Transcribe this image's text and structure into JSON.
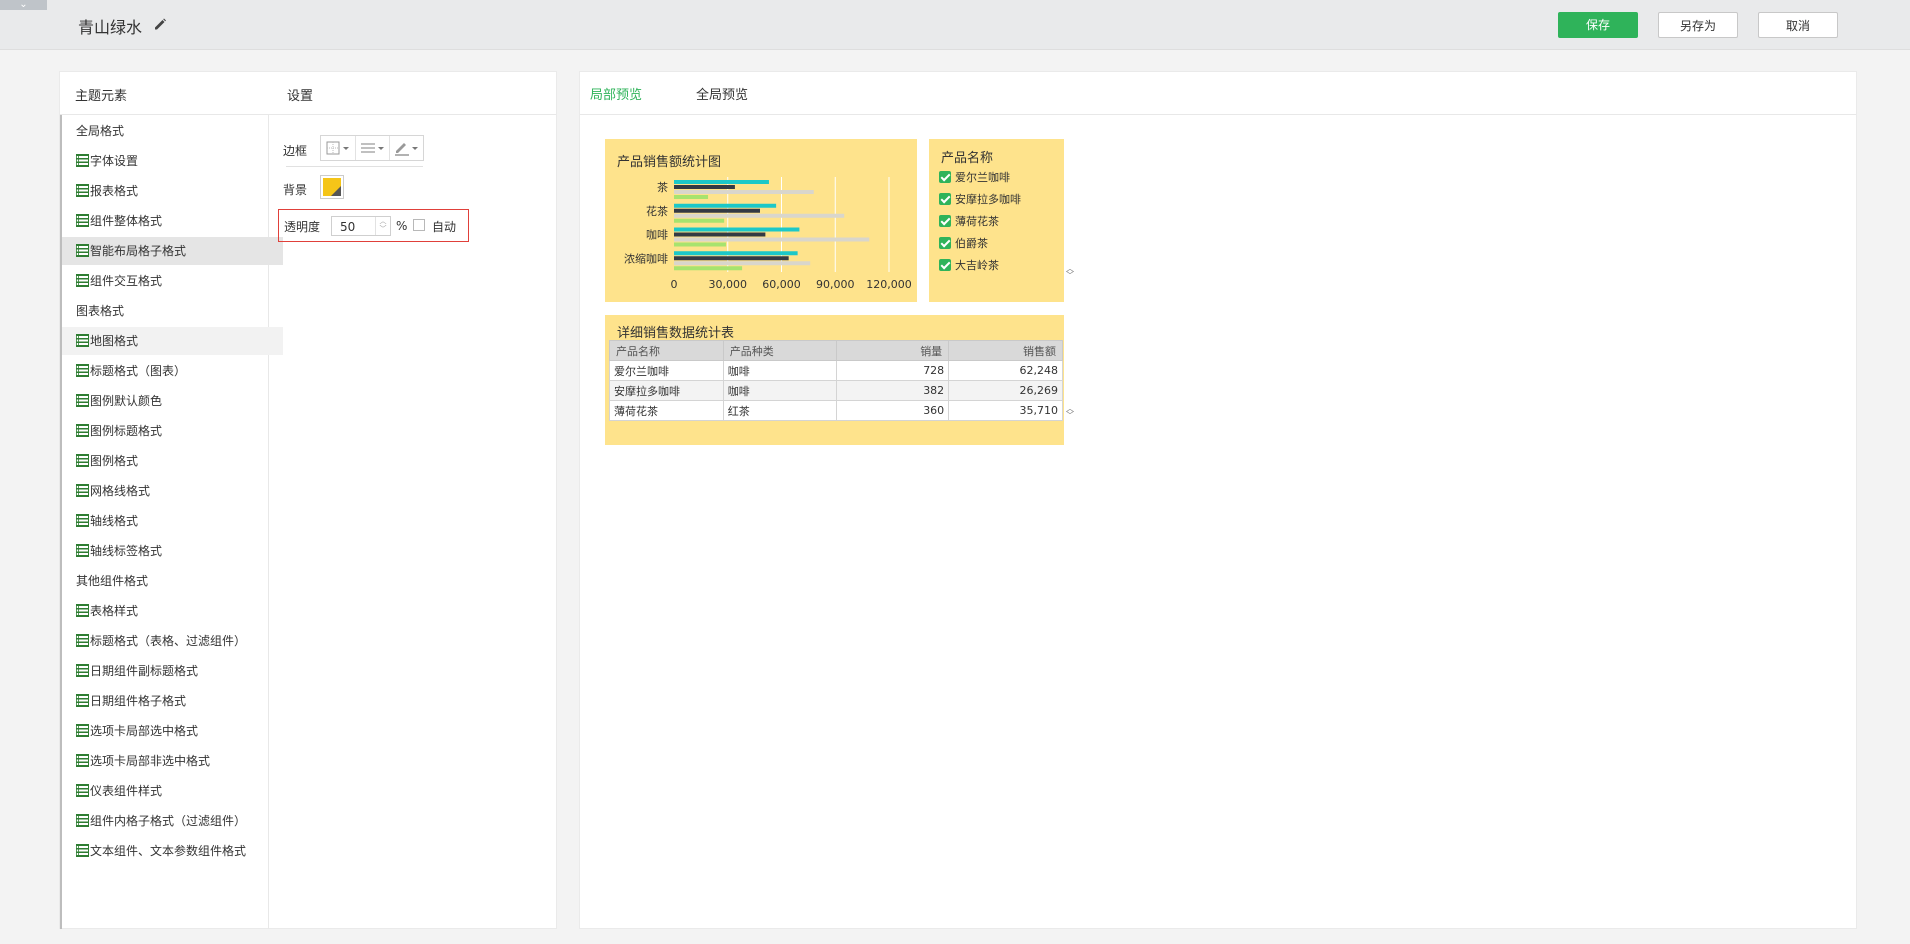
{
  "header": {
    "collapse_glyph": "⌄",
    "title": "青山绿水",
    "save": "保存",
    "save_as": "另存为",
    "cancel": "取消"
  },
  "left_panel": {
    "tree_title": "主题元素",
    "settings_title": "设置",
    "tree": [
      {
        "label": "全局格式",
        "type": "group"
      },
      {
        "label": "字体设置",
        "type": "child"
      },
      {
        "label": "报表格式",
        "type": "child"
      },
      {
        "label": "组件整体格式",
        "type": "child"
      },
      {
        "label": "智能布局格子格式",
        "type": "child",
        "selected": true
      },
      {
        "label": "组件交互格式",
        "type": "child"
      },
      {
        "label": "图表格式",
        "type": "group"
      },
      {
        "label": "地图格式",
        "type": "child",
        "hover": true
      },
      {
        "label": "标题格式（图表）",
        "type": "child"
      },
      {
        "label": "图例默认颜色",
        "type": "child"
      },
      {
        "label": "图例标题格式",
        "type": "child"
      },
      {
        "label": "图例格式",
        "type": "child"
      },
      {
        "label": "网格线格式",
        "type": "child"
      },
      {
        "label": "轴线格式",
        "type": "child"
      },
      {
        "label": "轴线标签格式",
        "type": "child"
      },
      {
        "label": "其他组件格式",
        "type": "group"
      },
      {
        "label": "表格样式",
        "type": "child"
      },
      {
        "label": "标题格式（表格、过滤组件）",
        "type": "child"
      },
      {
        "label": "日期组件副标题格式",
        "type": "child"
      },
      {
        "label": "日期组件格子格式",
        "type": "child"
      },
      {
        "label": "选项卡局部选中格式",
        "type": "child"
      },
      {
        "label": "选项卡局部非选中格式",
        "type": "child"
      },
      {
        "label": "仪表组件样式",
        "type": "child"
      },
      {
        "label": "组件内格子格式（过滤组件）",
        "type": "child"
      },
      {
        "label": "文本组件、文本参数组件格式",
        "type": "child"
      }
    ],
    "settings": {
      "border_label": "边框",
      "background_label": "背景",
      "background_color": "#f5c518",
      "opacity_label": "透明度",
      "opacity_value": "50",
      "percent_sign": "%",
      "auto_label": "自动"
    }
  },
  "preview": {
    "tab_local": "局部预览",
    "tab_global": "全局预览",
    "accent": "#2fb35a",
    "card_bg": "#fee38c",
    "chart_title": "产品销售额统计图",
    "legend_title": "产品名称",
    "legend_items": [
      "爱尔兰咖啡",
      "安摩拉多咖啡",
      "薄荷花茶",
      "伯爵茶",
      "大吉岭茶"
    ],
    "table_title": "详细销售数据统计表",
    "table_headers": [
      "产品名称",
      "产品种类",
      "销量",
      "销售额"
    ],
    "table_rows": [
      [
        "爱尔兰咖啡",
        "咖啡",
        "728",
        "62,248"
      ],
      [
        "安摩拉多咖啡",
        "咖啡",
        "382",
        "26,269"
      ],
      [
        "薄荷花茶",
        "红茶",
        "360",
        "35,710"
      ]
    ]
  },
  "chart_data": {
    "type": "bar",
    "orientation": "horizontal",
    "title": "产品销售额统计图",
    "categories": [
      "茶",
      "花茶",
      "咖啡",
      "浓缩咖啡"
    ],
    "x_ticks": [
      "0",
      "30,000",
      "60,000",
      "90,000",
      "120,000"
    ],
    "xlim": [
      0,
      120000
    ],
    "grid": true,
    "series": [
      {
        "name": "爱尔兰咖啡",
        "color": "#1cc8c8",
        "values": [
          53000,
          57000,
          70000,
          69000
        ]
      },
      {
        "name": "安摩拉多咖啡",
        "color": "#333a44",
        "values": [
          34000,
          48000,
          51000,
          64000
        ]
      },
      {
        "name": "薄荷花茶",
        "color": "#d9d6cc",
        "values": [
          78000,
          95000,
          109000,
          76000
        ]
      },
      {
        "name": "伯爵茶",
        "color": "#a7e36e",
        "values": [
          19000,
          28000,
          29000,
          38000
        ]
      }
    ]
  }
}
